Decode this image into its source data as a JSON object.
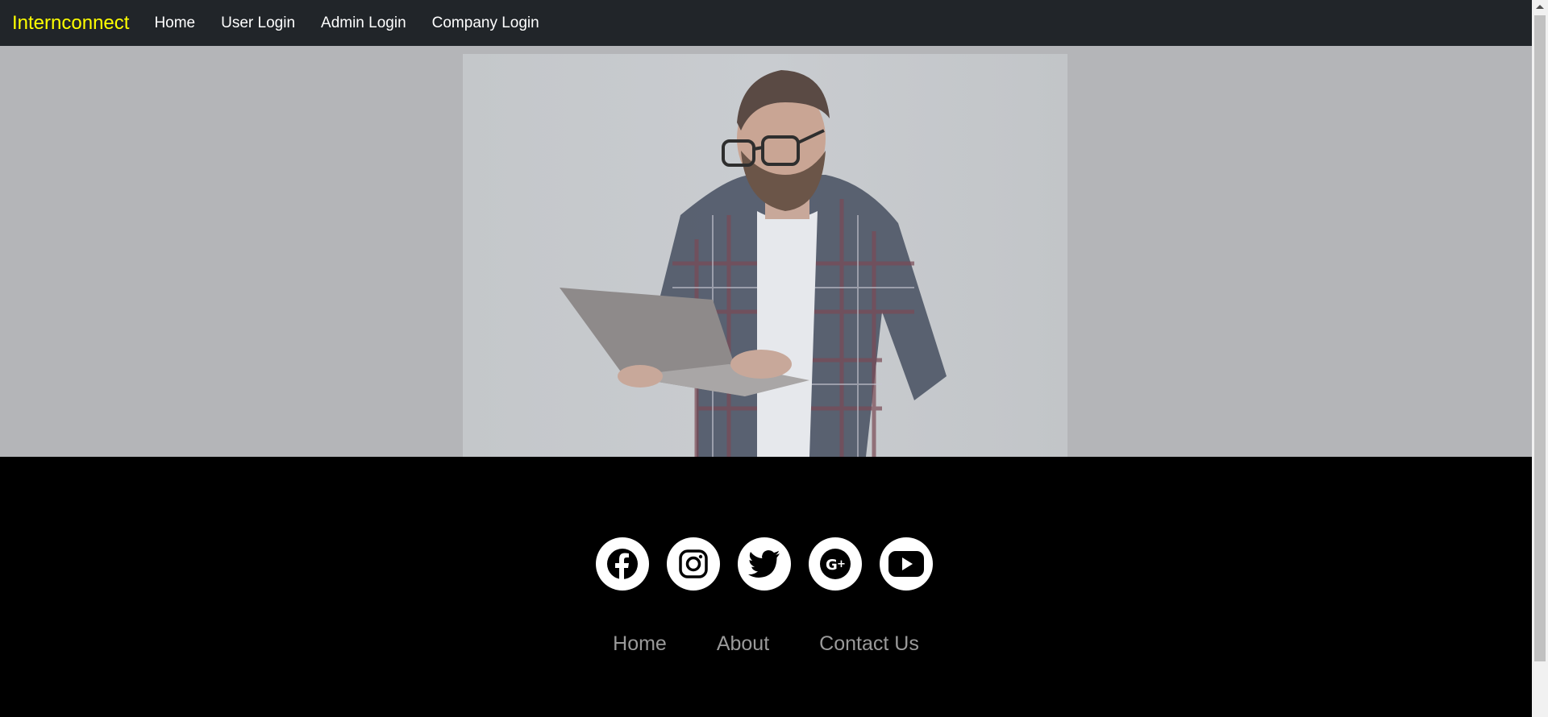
{
  "navbar": {
    "brand": "Internconnect",
    "links": [
      "Home",
      "User Login",
      "Admin Login",
      "Company Login"
    ]
  },
  "hero": {
    "image": "man-with-laptop-photo"
  },
  "footer": {
    "social_icons": [
      "facebook-icon",
      "instagram-icon",
      "twitter-icon",
      "google-plus-icon",
      "youtube-icon"
    ],
    "links": [
      "Home",
      "About",
      "Contact Us"
    ]
  },
  "colors": {
    "navbar_bg": "#212529",
    "brand": "#ffff00",
    "footer_bg": "#000000",
    "footer_link": "#9a9a9a"
  }
}
